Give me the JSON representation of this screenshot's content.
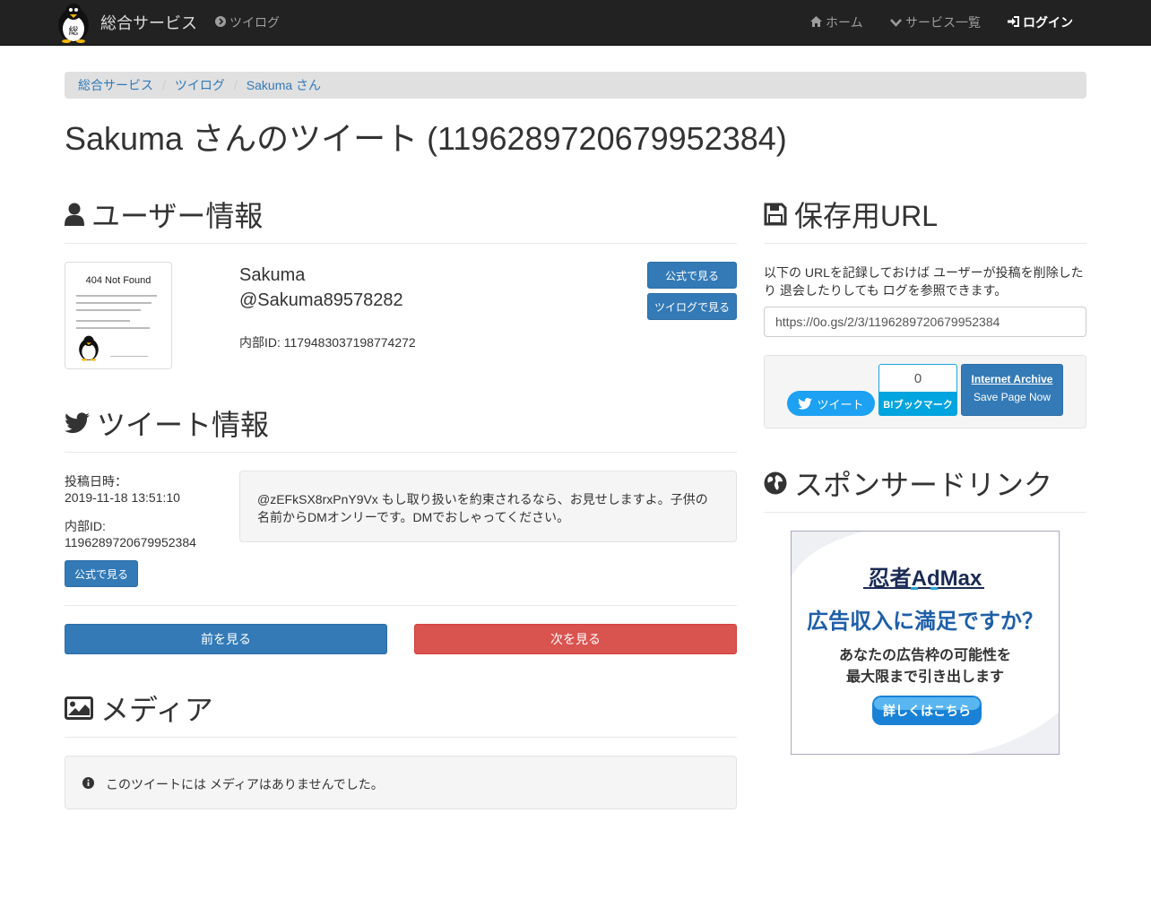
{
  "navbar": {
    "brand": "総合サービス",
    "twilog": "ツイログ",
    "home": "ホーム",
    "services": "サービス一覧",
    "login": "ログイン"
  },
  "breadcrumb": [
    "総合サービス",
    "ツイログ",
    "Sakuma さん"
  ],
  "page_title": "Sakuma さんのツイート (1196289720679952384)",
  "user_section": {
    "heading": "ユーザー情報",
    "thumb_text": "404 Not Found",
    "name": "Sakuma",
    "handle": "@Sakuma89578282",
    "internal_id": "内部ID: 1179483037198774272",
    "btn_official": "公式で見る",
    "btn_twilog": "ツイログで見る"
  },
  "tweet_section": {
    "heading": "ツイート情報",
    "posted_label": "投稿日時：",
    "posted_value": "2019-11-18 13:51:10",
    "id_label": "内部ID:",
    "id_value": "1196289720679952384",
    "btn_official": "公式で見る",
    "text_line1": "@zEFkSX8rxPnY9Vx もし取り扱いを約束されるなら、お見せしますよ。子供の",
    "text_line2": "名前からDMオンリーです。DMでおしゃってください。"
  },
  "nav_buttons": {
    "prev": "前を見る",
    "next": "次を見る"
  },
  "media_section": {
    "heading": "メディア",
    "notice": "このツイートには メディアはありませんでした。"
  },
  "save_section": {
    "heading": "保存用URL",
    "desc_line1": "以下の URLを記録しておけば ユーザーが投稿を削除した",
    "desc_line2": "り 退会したりしても ログを参照できます。",
    "url": "https://0o.gs/2/3/1196289720679952384",
    "tweet_btn": "ツイート",
    "hatena_count": "0",
    "hatena_btn": "B!ブックマーク",
    "ia_title": "Internet Archive",
    "ia_sub": "Save Page Now"
  },
  "sponsor_section": {
    "heading": "スポンサードリンク",
    "ad_logo": "忍者AdMax",
    "ad_headline": "広告収入に満足ですか？",
    "ad_line1": "あなたの広告枠の可能性を",
    "ad_line2": "最大限まで引き出します",
    "ad_button": "詳しくはこちら"
  },
  "colors": {
    "primary": "#337ab7",
    "danger": "#d9534f",
    "navbar": "#222222",
    "twitter": "#1da1f2",
    "hatena": "#00a4de"
  }
}
